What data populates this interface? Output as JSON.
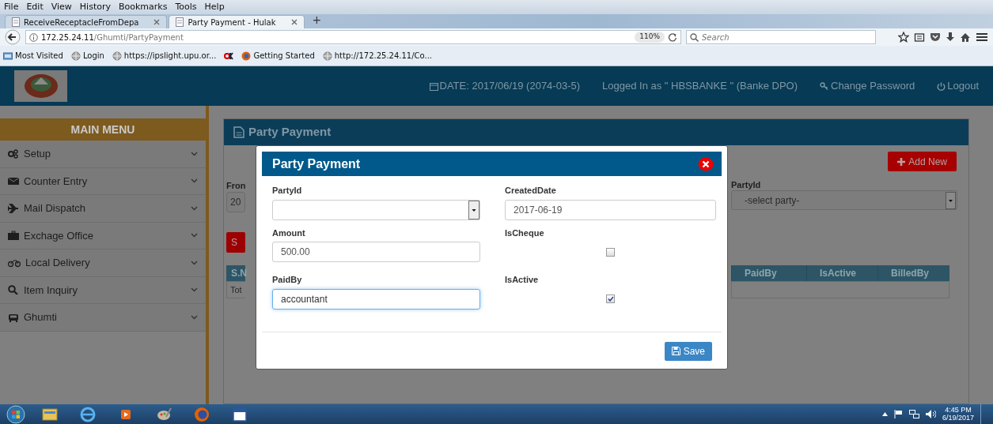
{
  "browser": {
    "menu": [
      "File",
      "Edit",
      "View",
      "History",
      "Bookmarks",
      "Tools",
      "Help"
    ],
    "tabs": [
      {
        "label": "ReceiveReceptacleFromDepa",
        "selected": false
      },
      {
        "label": "Party Payment - Hulak",
        "selected": true
      }
    ],
    "new_tab": "+",
    "address": {
      "host": "172.25.24.11",
      "path": "/Ghumti/PartyPayment"
    },
    "zoom": "110%",
    "search": {
      "placeholder": "Search"
    },
    "bookmarks": [
      {
        "label": "Most Visited",
        "kind": "folder"
      },
      {
        "label": "Login",
        "kind": "globe"
      },
      {
        "label": "https://ipslight.upu.or...",
        "kind": "globe"
      },
      {
        "kind": "ok"
      },
      {
        "label": "Getting Started",
        "kind": "firefox"
      },
      {
        "label": "http://172.25.24.11/Co...",
        "kind": "globe"
      }
    ]
  },
  "header": {
    "date": "DATE: 2017/06/19 (2074-03-5)",
    "user": "Logged In as \" HBSBANKE \" (Banke DPO)",
    "change_password": "Change Password",
    "logout": "Logout"
  },
  "sidebar": {
    "title": "MAIN MENU",
    "items": [
      {
        "label": "Setup",
        "kind": "gears"
      },
      {
        "label": "Counter Entry",
        "kind": "envelope"
      },
      {
        "label": "Mail Dispatch",
        "kind": "plane"
      },
      {
        "label": "Exchage Office",
        "kind": "briefcase"
      },
      {
        "label": "Local Delivery",
        "kind": "bicycle"
      },
      {
        "label": "Item Inquiry",
        "kind": "search"
      },
      {
        "label": "Ghumti",
        "kind": "car"
      }
    ]
  },
  "panel": {
    "title": "Party Payment",
    "add_button": "Add New",
    "from_label": "Fron",
    "from_value": "20",
    "search_button": "S",
    "party_label": "PartyId",
    "party_select": "-select party-",
    "table": {
      "columns": [
        "S.N",
        "PaidBy",
        "IsActive",
        "BilledBy"
      ],
      "footer": "Tot"
    }
  },
  "modal": {
    "title": "Party Payment",
    "fields": [
      {
        "label": "PartyId",
        "kind": "select"
      },
      {
        "label": "CreatedDate",
        "kind": "text",
        "value": "2017-06-19",
        "focused": false
      },
      {
        "label": "Amount",
        "kind": "text",
        "value": "500.00",
        "focused": false
      },
      {
        "label": "IsCheque",
        "kind": "checkbox",
        "checked": false
      },
      {
        "label": "PaidBy",
        "kind": "text",
        "value": "accountant",
        "focused": true
      },
      {
        "label": "IsActive",
        "kind": "checkbox",
        "checked": true
      }
    ],
    "save": "Save"
  },
  "taskbar": {
    "time": "4:45 PM",
    "date": "6/19/2017"
  }
}
